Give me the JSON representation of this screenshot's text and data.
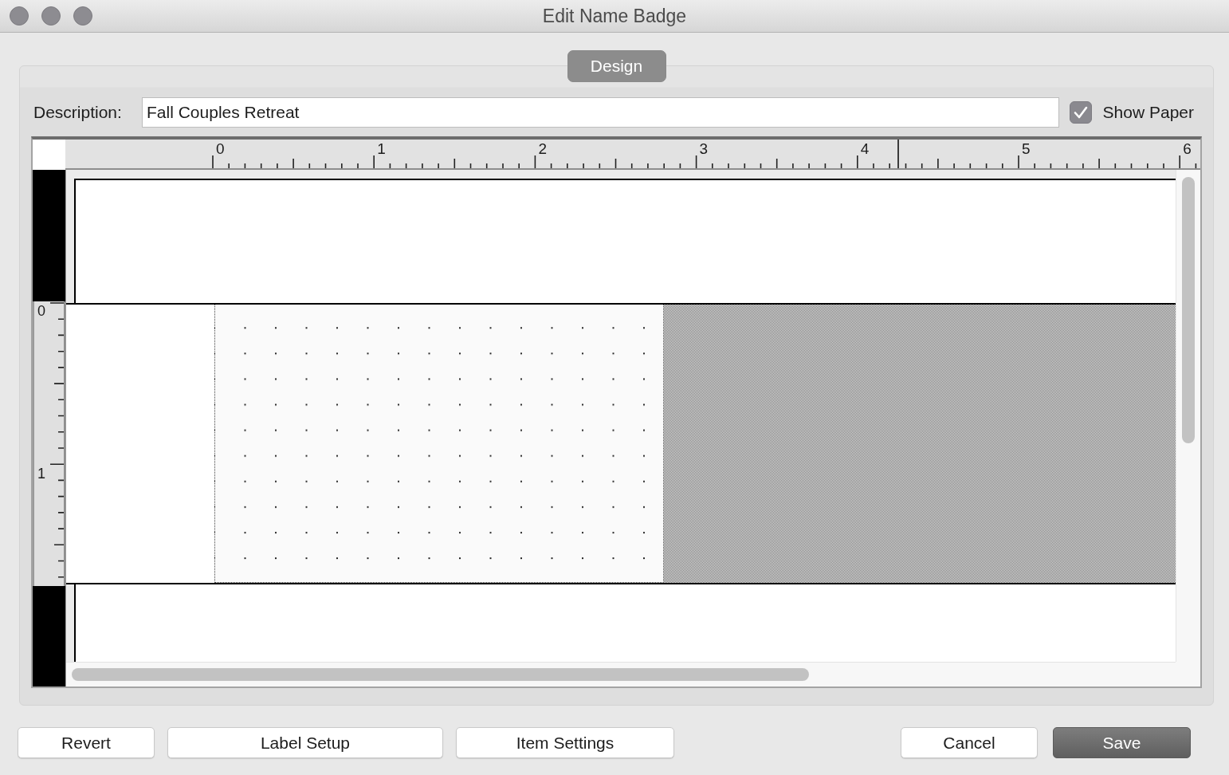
{
  "window": {
    "title": "Edit Name Badge"
  },
  "tabs": [
    {
      "label": "Design",
      "selected": true
    }
  ],
  "description": {
    "label": "Description:",
    "value": "Fall Couples Retreat"
  },
  "show_paper": {
    "label": "Show Paper",
    "checked": true
  },
  "horizontal_ruler": {
    "labels": [
      "0",
      "1",
      "2",
      "3",
      "4",
      "5",
      "6"
    ]
  },
  "vertical_ruler": {
    "labels": [
      "0",
      "1"
    ]
  },
  "left_buttons": [
    {
      "label": "Revert",
      "kind": "push"
    },
    {
      "label": "Label Setup",
      "kind": "push"
    },
    {
      "label": "Item Settings",
      "kind": "push"
    }
  ],
  "right_buttons": [
    {
      "label": "Cancel",
      "kind": "push"
    },
    {
      "label": "Save",
      "kind": "default"
    }
  ]
}
